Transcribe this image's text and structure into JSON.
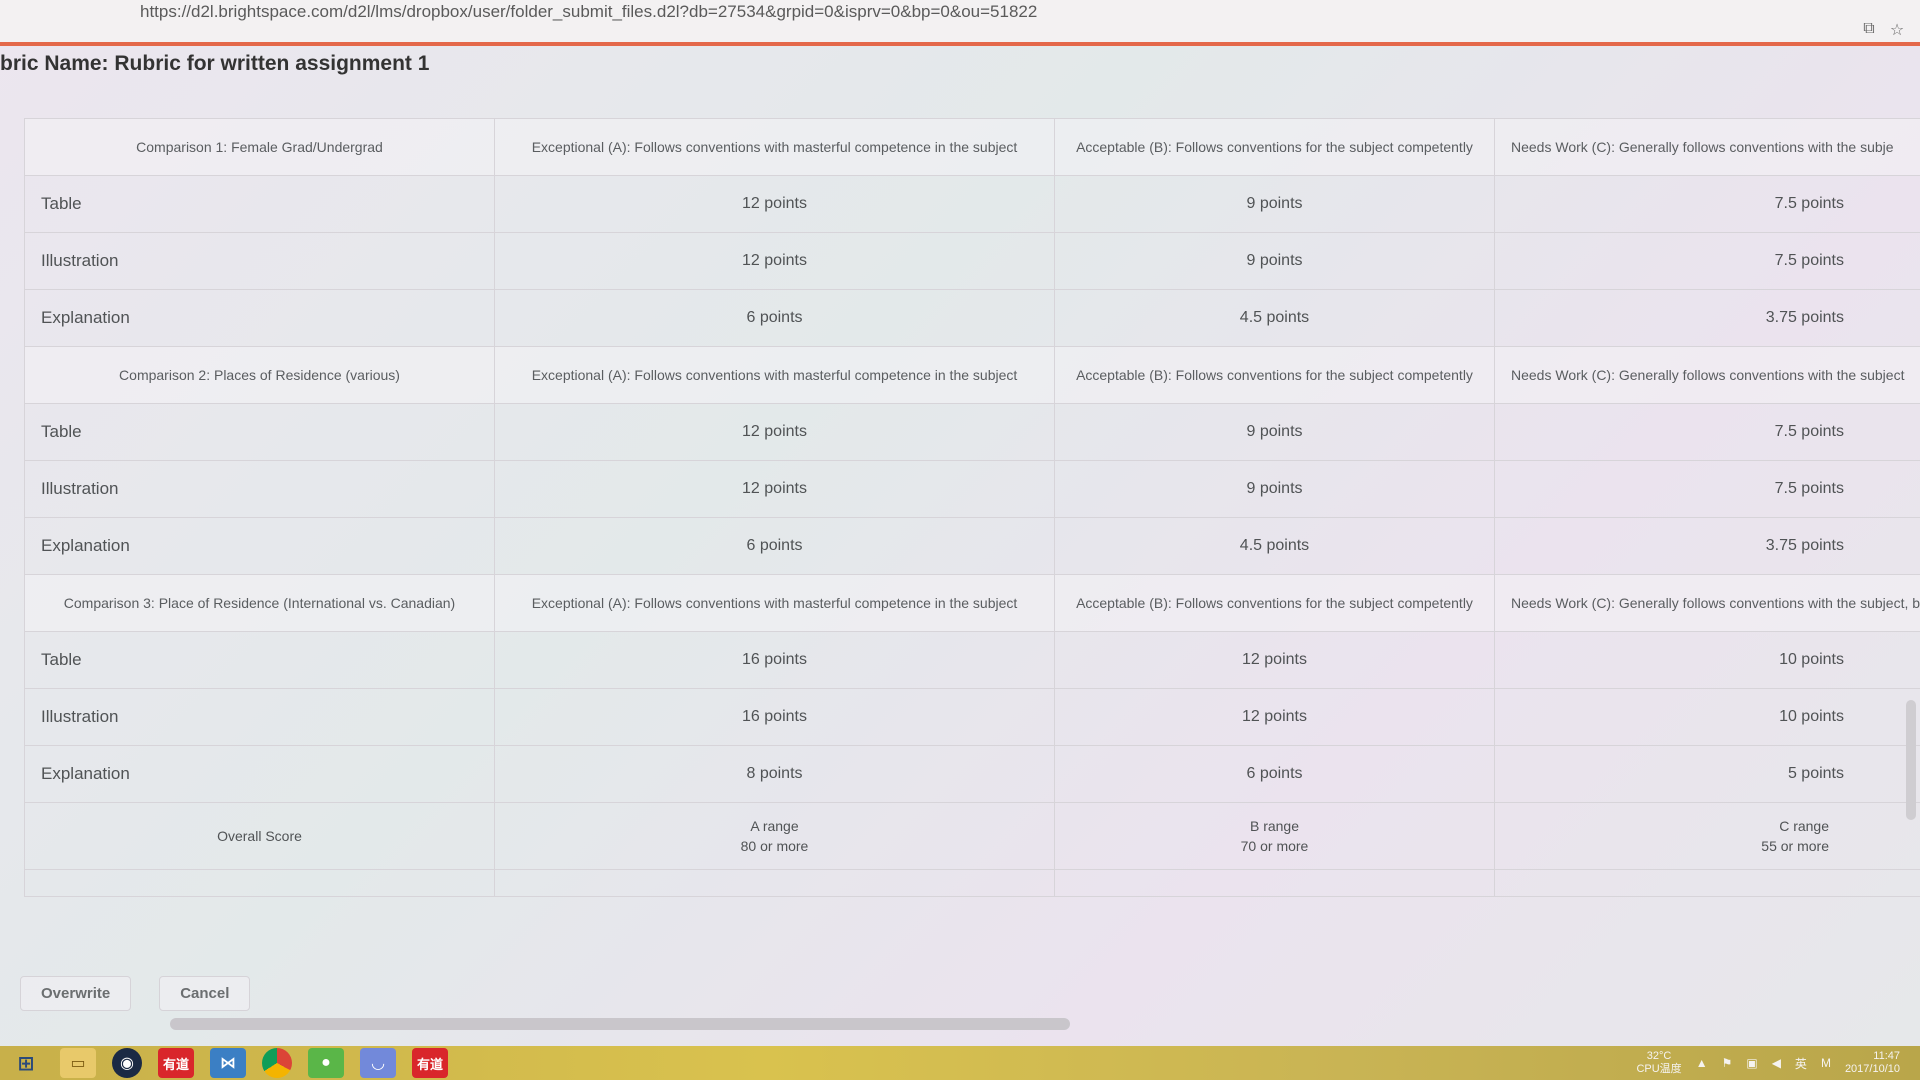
{
  "browser": {
    "url": "https://d2l.brightspace.com/d2l/lms/dropbox/user/folder_submit_files.d2l?db=27534&grpid=0&isprv=0&bp=0&ou=51822"
  },
  "page": {
    "title": "bric Name: Rubric for written assignment 1"
  },
  "rubric": {
    "sections": [
      {
        "header": "Comparison 1: Female Grad/Undergrad",
        "levels": [
          "Exceptional (A): Follows conventions with masterful competence in the subject",
          "Acceptable (B): Follows conventions for the subject competently",
          "Needs Work (C): Generally follows conventions with the subje"
        ],
        "rows": [
          {
            "criterion": "Table",
            "a": "12 points",
            "b": "9 points",
            "c": "7.5 points"
          },
          {
            "criterion": "Illustration",
            "a": "12 points",
            "b": "9 points",
            "c": "7.5 points"
          },
          {
            "criterion": "Explanation",
            "a": "6 points",
            "b": "4.5 points",
            "c": "3.75 points"
          }
        ]
      },
      {
        "header": "Comparison 2: Places of Residence (various)",
        "levels": [
          "Exceptional (A): Follows conventions with masterful competence in the subject",
          "Acceptable (B): Follows conventions for the subject competently",
          "Needs Work (C): Generally follows conventions with the subject"
        ],
        "rows": [
          {
            "criterion": "Table",
            "a": "12 points",
            "b": "9 points",
            "c": "7.5 points"
          },
          {
            "criterion": "Illustration",
            "a": "12 points",
            "b": "9 points",
            "c": "7.5 points"
          },
          {
            "criterion": "Explanation",
            "a": "6 points",
            "b": "4.5 points",
            "c": "3.75 points"
          }
        ]
      },
      {
        "header": "Comparison 3: Place of Residence (International vs. Canadian)",
        "levels": [
          "Exceptional (A): Follows conventions with masterful competence in the subject",
          "Acceptable (B): Follows conventions for the subject competently",
          "Needs Work (C): Generally follows conventions with the subject, bu"
        ],
        "rows": [
          {
            "criterion": "Table",
            "a": "16 points",
            "b": "12 points",
            "c": "10 points"
          },
          {
            "criterion": "Illustration",
            "a": "16 points",
            "b": "12 points",
            "c": "10 points"
          },
          {
            "criterion": "Explanation",
            "a": "8 points",
            "b": "6 points",
            "c": "5 points"
          }
        ]
      }
    ],
    "overall": {
      "label": "Overall Score",
      "a_range": "A range",
      "a_min": "80 or more",
      "b_range": "B range",
      "b_min": "70 or more",
      "c_range": "C range",
      "c_min": "55 or more"
    }
  },
  "actions": {
    "overwrite": "Overwrite",
    "cancel": "Cancel"
  },
  "taskbar": {
    "youdao_label": "有道",
    "youdao2_label": "有道",
    "cpu_temp": "32°C",
    "cpu_label": "CPU温度",
    "ime": "英",
    "ime2": "M",
    "time": "11:47",
    "date": "2017/10/10"
  }
}
